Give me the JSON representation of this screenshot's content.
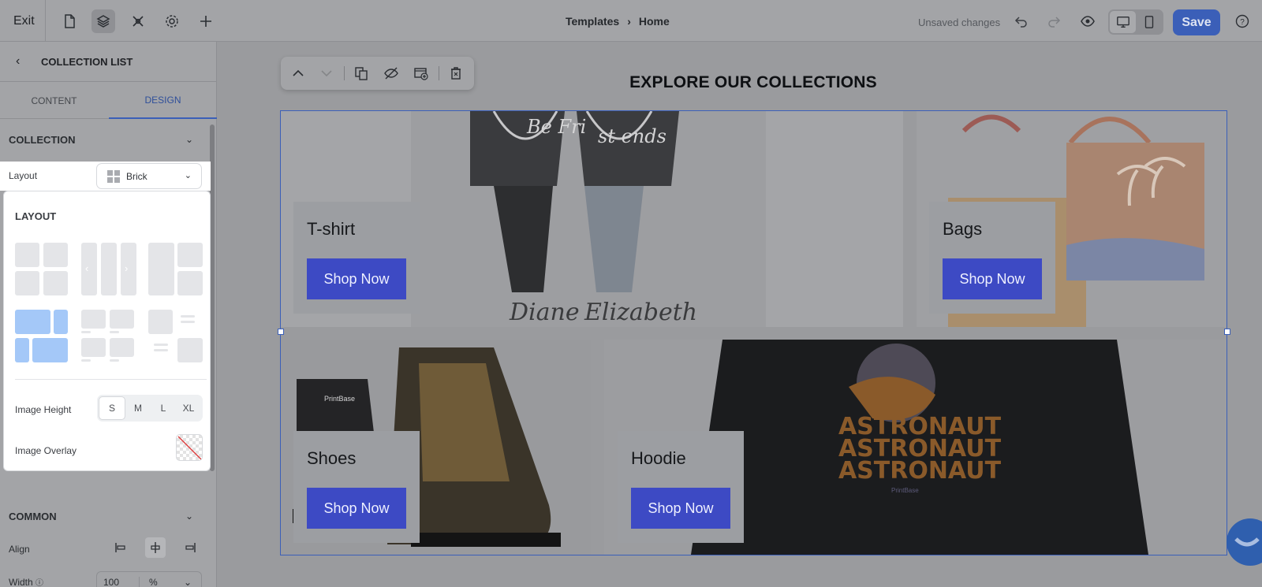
{
  "topbar": {
    "exit_label": "Exit",
    "icons": [
      "page-icon",
      "layers-icon",
      "tools-icon",
      "settings-icon",
      "add-icon"
    ],
    "breadcrumb": {
      "parent": "Templates",
      "current": "Home"
    },
    "status": "Unsaved changes",
    "save_label": "Save"
  },
  "left_panel": {
    "title": "COLLECTION LIST",
    "tabs": [
      {
        "label": "CONTENT",
        "active": false
      },
      {
        "label": "DESIGN",
        "active": true
      }
    ],
    "collection_section": "COLLECTION",
    "layout_label": "Layout",
    "layout_value": "Brick",
    "layout_popup": {
      "title": "LAYOUT",
      "selected_option": "brick",
      "image_height_label": "Image Height",
      "image_height_options": [
        "S",
        "M",
        "L",
        "XL"
      ],
      "image_height_selected": "S",
      "image_overlay_label": "Image Overlay"
    },
    "common_section": "COMMON",
    "align_label": "Align",
    "width_label": "Width",
    "width_value": "100",
    "width_unit": "%"
  },
  "canvas": {
    "heading": "EXPLORE OUR COLLECTIONS",
    "collections": [
      {
        "title": "T-shirt",
        "button": "Shop Now"
      },
      {
        "title": "Bags",
        "button": "Shop Now"
      },
      {
        "title": "Shoes",
        "button": "Shop Now"
      },
      {
        "title": "Hoodie",
        "button": "Shop Now"
      }
    ],
    "tshirt_print": {
      "heart_left": "Be Fri",
      "heart_right": "st ends",
      "name_left": "Diane",
      "name_right": "Elizabeth"
    },
    "shoe_brand": "PrintBase",
    "hoodie_print": [
      "ASTRONAUT",
      "ASTRONAUT",
      "ASTRONAUT"
    ],
    "hoodie_brand": "PrintBase"
  },
  "colors": {
    "accent": "#5b63e0",
    "overlay": "#9a9b9e",
    "save": "#3b5fb8"
  }
}
